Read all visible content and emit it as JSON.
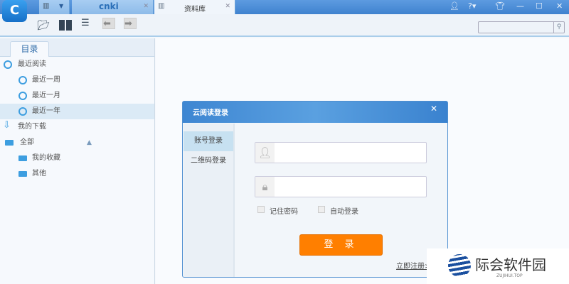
{
  "app": {
    "logo_text": "C"
  },
  "tabs": [
    {
      "label": "cnki"
    },
    {
      "label": "资料库"
    }
  ],
  "sidebar": {
    "tab": "目录",
    "items": [
      {
        "label": "最近阅读",
        "icon": "clock-icon",
        "level": 0
      },
      {
        "label": "最近一周",
        "icon": "clock-icon",
        "level": 1
      },
      {
        "label": "最近一月",
        "icon": "clock-icon",
        "level": 1
      },
      {
        "label": "最近一年",
        "icon": "clock-icon",
        "level": 1,
        "selected": true
      },
      {
        "label": "我的下载",
        "icon": "download-icon",
        "level": 0
      },
      {
        "label": "全部",
        "icon": "folder-icon",
        "level": 0
      },
      {
        "label": "我的收藏",
        "icon": "folder-icon",
        "level": 1
      },
      {
        "label": "其他",
        "icon": "folder-icon",
        "level": 1
      }
    ]
  },
  "search": {
    "placeholder": "",
    "value": ""
  },
  "dialog": {
    "title": "云阅读登录",
    "tabs": [
      "账号登录",
      "二维码登录"
    ],
    "username": {
      "value": "",
      "placeholder": ""
    },
    "password": {
      "value": "",
      "placeholder": ""
    },
    "remember": "记住密码",
    "auto_login": "自动登录",
    "login": "登 录",
    "register": "立即注册>"
  },
  "watermark": {
    "name": "际会软件园",
    "site": "ZUJIHUI.TOP"
  },
  "colors": {
    "accent": "#3f82cf",
    "login_button": "#ff7f00"
  }
}
